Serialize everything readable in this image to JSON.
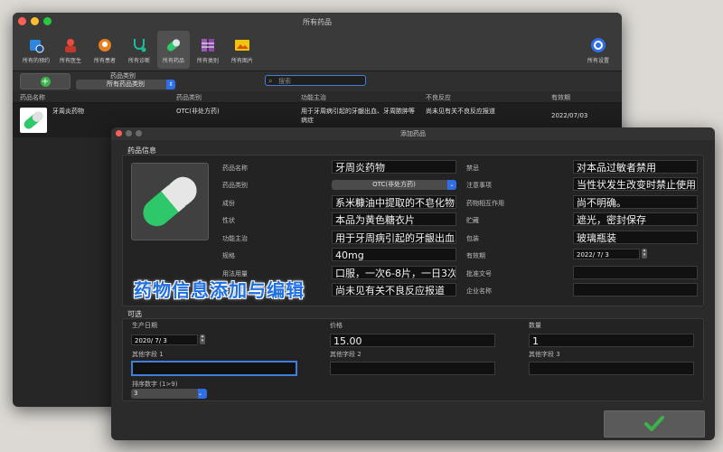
{
  "main_window": {
    "title": "所有药品",
    "toolbar": [
      {
        "label": "所有的预约",
        "icon": "calendar-icon"
      },
      {
        "label": "所有医生",
        "icon": "doctor-icon"
      },
      {
        "label": "所有患者",
        "icon": "patient-icon"
      },
      {
        "label": "所有诊断",
        "icon": "stethoscope-icon"
      },
      {
        "label": "所有药品",
        "icon": "pill-icon"
      },
      {
        "label": "所有类别",
        "icon": "categories-icon"
      },
      {
        "label": "所有图片",
        "icon": "image-icon"
      }
    ],
    "settings_label": "所有设置",
    "category_filter_label": "药品类别",
    "category_filter_value": "所有药品类别",
    "search_placeholder": "搜索",
    "columns": [
      "药品名称",
      "药品类别",
      "功能主治",
      "不良反应",
      "有效期"
    ],
    "rows": [
      {
        "name": "牙周炎药物",
        "category": "OTC(非处方药)",
        "indication_line1": "用于牙周病引起的牙龈出血、牙周脓肿等",
        "indication_line2": "病症",
        "adverse": "尚未见有关不良反应报道",
        "expiry": "2022/07/03"
      }
    ]
  },
  "dialog": {
    "title": "添加药品",
    "section_info": "药品信息",
    "fields_left": [
      {
        "label": "药品名称",
        "value": "牙周炎药物"
      },
      {
        "label": "药品类别",
        "value": "OTC(非处方药)"
      },
      {
        "label": "成份",
        "value": "系米糠油中提取的不皂化物"
      },
      {
        "label": "性状",
        "value": "本品为黄色糖衣片"
      },
      {
        "label": "功能主治",
        "value": "用于牙周病引起的牙龈出血、"
      },
      {
        "label": "规格",
        "value": "40mg"
      },
      {
        "label": "用法用量",
        "value": "口服，一次6-8片，一日3次"
      },
      {
        "label": "不良反应",
        "value": "尚未见有关不良反应报道"
      }
    ],
    "fields_right": [
      {
        "label": "禁忌",
        "value": "对本品过敏者禁用"
      },
      {
        "label": "注意事项",
        "value": "当性状发生改变时禁止使用"
      },
      {
        "label": "药物相互作用",
        "value": "尚不明确。"
      },
      {
        "label": "贮藏",
        "value": "遮光，密封保存"
      },
      {
        "label": "包装",
        "value": "玻璃瓶装"
      },
      {
        "label": "有效期",
        "value": "2022/  7/  3"
      },
      {
        "label": "批准文号",
        "value": ""
      },
      {
        "label": "企业名称",
        "value": ""
      }
    ],
    "section_optional": "可选",
    "production_date_label": "生产日期",
    "production_date_value": "2020/  7/  3",
    "price_label": "价格",
    "price_value": "15.00",
    "quantity_label": "数量",
    "quantity_value": "1",
    "extra1_label": "其他字段 1",
    "extra2_label": "其他字段 2",
    "extra3_label": "其他字段 3",
    "sort_label": "排序数字 (1>9)",
    "sort_value": "3",
    "banner": "药物信息添加与编辑"
  },
  "colors": {
    "accent": "#2e6ee6",
    "pill_green": "#2ec86a",
    "ok_green": "#3cb34a"
  }
}
